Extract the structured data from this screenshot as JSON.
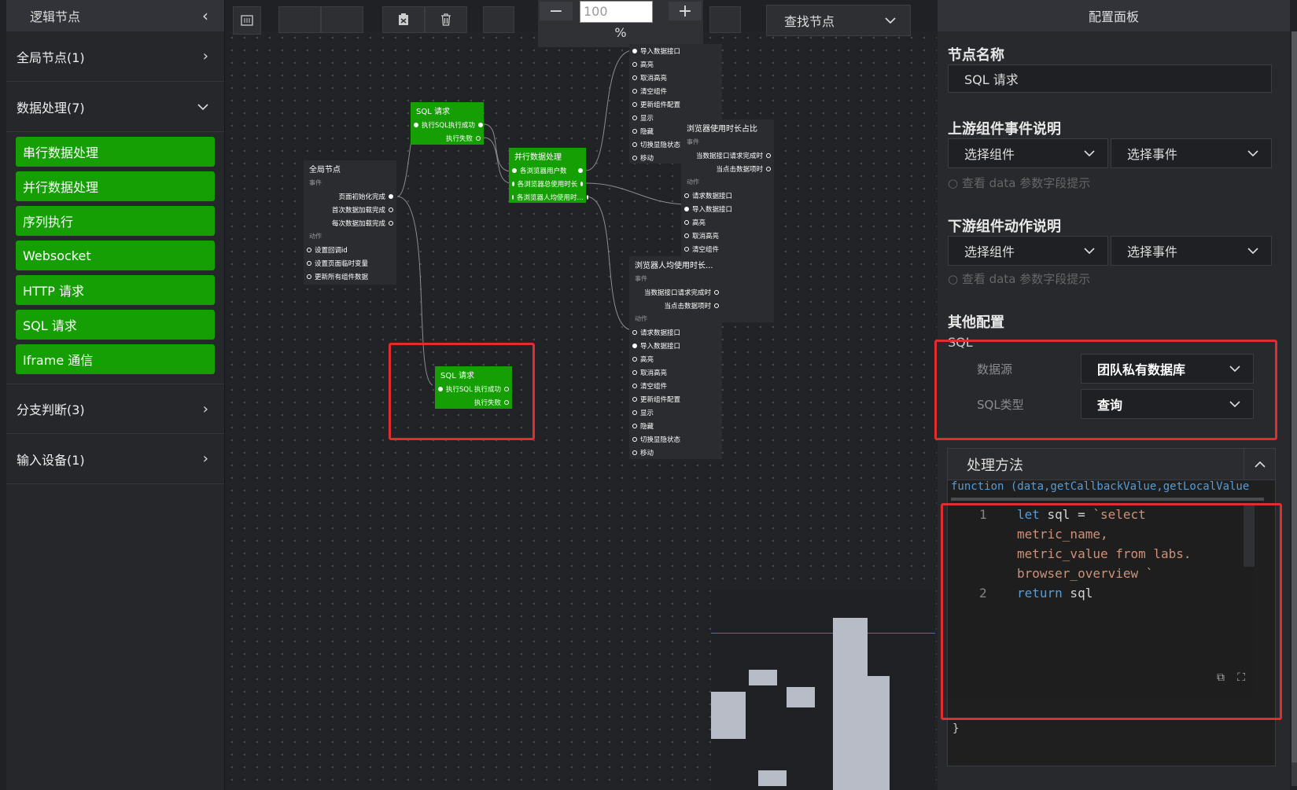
{
  "left_panel": {
    "title": "逻辑节点",
    "categories": [
      {
        "label": "全局节点(1)",
        "chev": "›"
      },
      {
        "label": "数据处理(7)",
        "chev": "⌄"
      },
      {
        "label": "分支判断(3)",
        "chev": "›"
      },
      {
        "label": "输入设备(1)",
        "chev": "›"
      }
    ],
    "items": [
      "串行数据处理",
      "并行数据处理",
      "序列执行",
      "Websocket",
      "HTTP 请求",
      "SQL 请求",
      "Iframe 通信"
    ]
  },
  "toolbar": {
    "zoom_value": "100",
    "zoom_unit": "%",
    "minus": "−",
    "plus": "+",
    "find_label": "查找节点"
  },
  "nodes": {
    "sql1": {
      "title": "SQL 请求",
      "in": "执行SQL",
      "out1": "执行成功",
      "out2": "执行失败"
    },
    "sql2": {
      "title": "SQL 请求",
      "in": "执行SQL",
      "out1": "执行成功",
      "out2": "执行失败"
    },
    "global": {
      "title": "全局节点",
      "event": "事件",
      "events": [
        "页面初始化完成",
        "首次数据加载完成",
        "每次数据加载完成"
      ],
      "action": "动作",
      "actions": [
        "设置回调id",
        "设置页面临时变量",
        "更新所有组件数据"
      ]
    },
    "parallel": {
      "title": "并行数据处理",
      "rows": [
        "各浏览器用户数",
        "各浏览器总使用时长",
        "各浏览器人均使用时..."
      ]
    },
    "comp_top": {
      "actions": [
        "导入数据接口",
        "高亮",
        "取消高亮",
        "清空组件",
        "更新组件配置",
        "显示",
        "隐藏",
        "切换显隐状态",
        "移动"
      ]
    },
    "ratio": {
      "title": "浏览器使用时长占比",
      "event": "事件",
      "events": [
        "当数据接口请求完成时",
        "当点击数据项时"
      ],
      "action": "动作",
      "actions": [
        "请求数据接口",
        "导入数据接口",
        "高亮",
        "取消高亮",
        "清空组件"
      ]
    },
    "avg": {
      "title": "浏览器人均使用时长...",
      "event": "事件",
      "events": [
        "当数据接口请求完成时",
        "当点击数据项时"
      ],
      "action": "动作",
      "actions": [
        "请求数据接口",
        "导入数据接口",
        "高亮",
        "取消高亮",
        "清空组件",
        "更新组件配置",
        "显示",
        "隐藏",
        "切换显隐状态",
        "移动"
      ]
    }
  },
  "right_panel": {
    "title": "配置面板",
    "node_name_label": "节点名称",
    "node_name_value": "SQL 请求",
    "upstream_label": "上游组件事件说明",
    "downstream_label": "下游组件动作说明",
    "select_component": "选择组件",
    "select_event": "选择事件",
    "hint": "查看 data 参数字段提示",
    "other_label": "其他配置",
    "sql_label": "SQL",
    "datasource_label": "数据源",
    "datasource_value": "团队私有数据库",
    "sqltype_label": "SQL类型",
    "sqltype_value": "查询",
    "method_label": "处理方法",
    "fn_signature": "function (data,getCallbackValue,getLocalValue",
    "closing_brace": "}",
    "code": {
      "line1_no": "1",
      "line2_no": "2",
      "l1a": "let",
      "l1b": " sql = ",
      "l1c": "`select",
      "l1d": "metric_name,",
      "l1e": "metric_value from labs.",
      "l1f": "browser_overview `",
      "l2a": "return",
      "l2b": " sql"
    }
  },
  "colors": {
    "accent_green": "#159f05",
    "highlight_red": "#e02d2d"
  }
}
